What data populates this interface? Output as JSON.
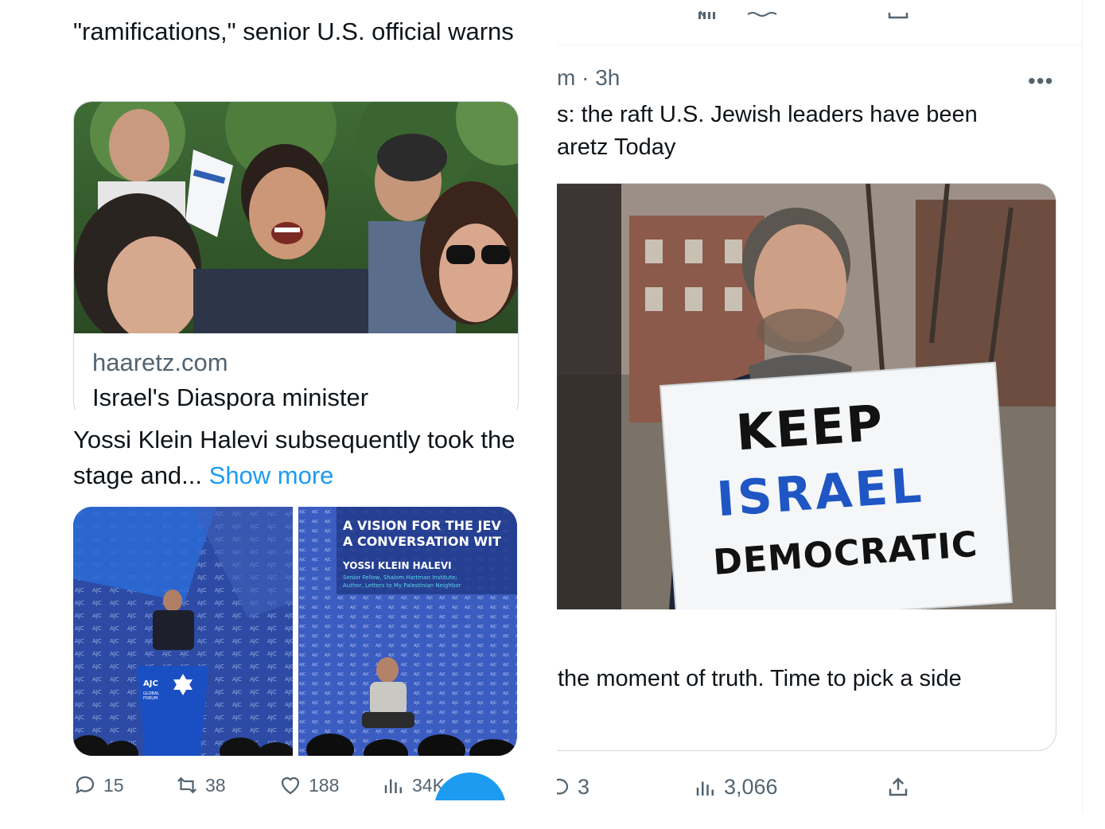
{
  "left_tweet": {
    "headline": "\"ramifications,\" senior U.S. official warns",
    "link_card": {
      "domain": "haaretz.com",
      "title": "Israel's Diaspora minister"
    },
    "body_text": "Yossi Klein Halevi subsequently took the stage and...",
    "show_more": "Show more",
    "media": {
      "left_image_text": [
        "AJC",
        "GLOBAL",
        "FORUM"
      ],
      "right_image_heading": [
        "A VISION FOR THE JEV",
        "A CONVERSATION WIT"
      ],
      "right_image_name": "YOSSI KLEIN HALEVI",
      "right_image_sub": [
        "Senior Fellow, Shalom Hartman Institute;",
        "Author, Letters to My Palestinian Neighbor"
      ]
    },
    "actions": {
      "replies": "15",
      "reposts": "38",
      "likes": "188",
      "views": "34K"
    }
  },
  "right_tweet": {
    "top_strip": "/     ~'      ıılı     ',~~~",
    "meta": "m · 3h",
    "more": "•••",
    "text": "s: the raft U.S. Jewish leaders have been\naretz Today",
    "sign": {
      "line1": "KEEP",
      "line2": "ISRAEL",
      "line3": "DEMOCRATIC"
    },
    "card_title": "the moment of truth. Time to pick a side",
    "actions": {
      "replies": "3",
      "views": "3,066"
    }
  },
  "colors": {
    "accent": "#1d9bf0",
    "text_primary": "#0f1419",
    "text_secondary": "#536471",
    "border": "#cfd9de"
  }
}
